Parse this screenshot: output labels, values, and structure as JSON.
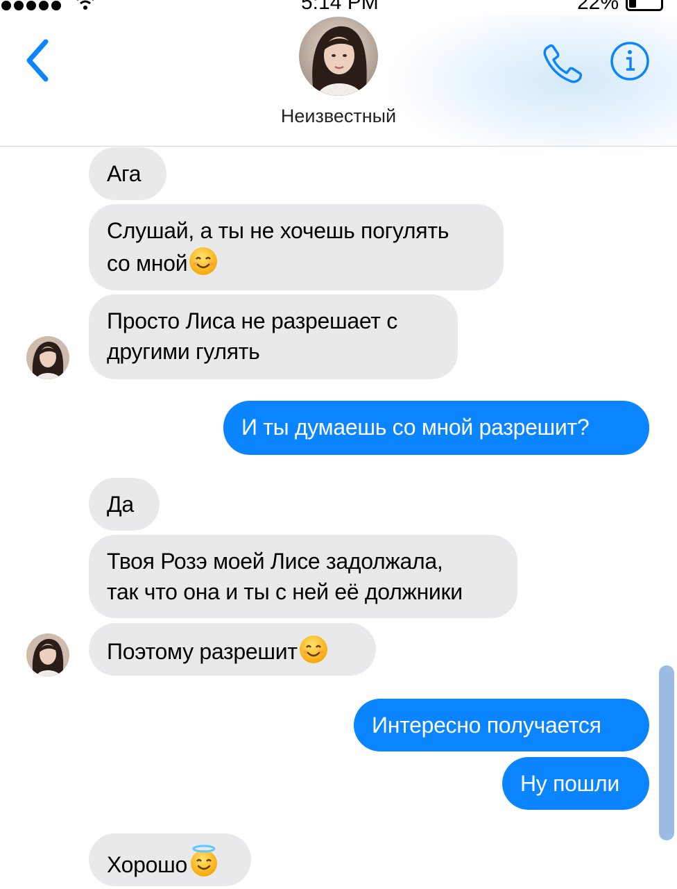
{
  "status_bar": {
    "time": "5:14 PM",
    "battery": "22%",
    "battery_level": 0.22,
    "signal_icon": "cellular-dots-icon",
    "wifi_icon": "wifi-icon"
  },
  "header": {
    "contact_name": "Неизвестный",
    "back_icon": "chevron-left-icon",
    "call_icon": "phone-icon",
    "info_icon": "info-icon"
  },
  "colors": {
    "accent": "#0a84ff",
    "incoming_bubble": "#e9e9eb",
    "outgoing_bubble": "#0a84ff"
  },
  "messages": [
    {
      "direction": "in",
      "lines": [
        "Ага"
      ]
    },
    {
      "direction": "in",
      "lines": [
        "Слушай, а ты не хочешь погулять",
        "со мной"
      ],
      "emoji": "smiling-face-icon"
    },
    {
      "direction": "in",
      "lines": [
        "Просто Лиса не разрешает с",
        "другими гулять"
      ]
    },
    {
      "direction": "out",
      "lines": [
        "И ты думаешь со мной разрешит?"
      ]
    },
    {
      "direction": "in",
      "lines": [
        "Да"
      ]
    },
    {
      "direction": "in",
      "lines": [
        "Твоя Розэ моей Лисе задолжала,",
        "так что она и ты с ней её должники"
      ]
    },
    {
      "direction": "in",
      "lines": [
        "Поэтому разрешит"
      ],
      "emoji": "smiling-face-icon"
    },
    {
      "direction": "out",
      "lines": [
        "Интересно получается"
      ]
    },
    {
      "direction": "out",
      "lines": [
        "Ну пошли"
      ]
    },
    {
      "direction": "in",
      "lines": [
        "Хорошо"
      ],
      "emoji": "smiling-face-with-halo-icon"
    }
  ]
}
